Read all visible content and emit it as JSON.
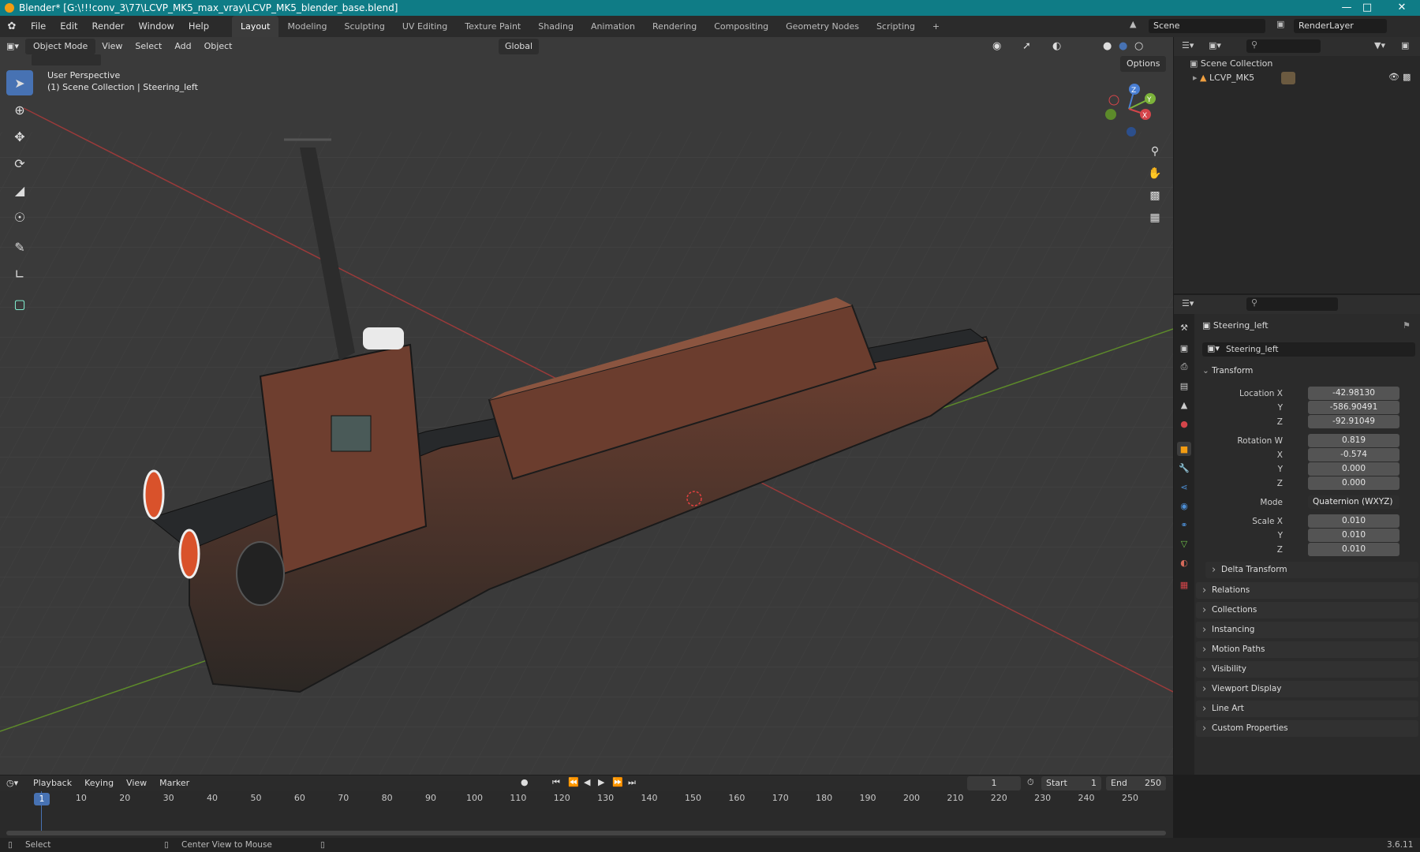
{
  "window": {
    "title": "Blender* [G:\\!!!conv_3\\77\\LCVP_MK5_max_vray\\LCVP_MK5_blender_base.blend]"
  },
  "menu": [
    "File",
    "Edit",
    "Render",
    "Window",
    "Help"
  ],
  "workspaces": [
    "Layout",
    "Modeling",
    "Sculpting",
    "UV Editing",
    "Texture Paint",
    "Shading",
    "Animation",
    "Rendering",
    "Compositing",
    "Geometry Nodes",
    "Scripting"
  ],
  "scene": {
    "name": "Scene",
    "render_layer": "RenderLayer"
  },
  "viewport": {
    "mode": "Object Mode",
    "menus": [
      "View",
      "Select",
      "Add",
      "Object"
    ],
    "orientation": "Global",
    "options": "Options",
    "overlay_title": "User Perspective",
    "overlay_sub": "(1) Scene Collection | Steering_left",
    "gizmo": {
      "z": "Z",
      "y": "Y",
      "x": "X"
    }
  },
  "outliner": {
    "root": "Scene Collection",
    "item": "LCVP_MK5"
  },
  "properties": {
    "object_name": "Steering_left",
    "data_name": "Steering_left",
    "transform_label": "Transform",
    "location": {
      "label": "Location X",
      "x": "-42.98130",
      "y": "-586.90491",
      "z": "-92.91049"
    },
    "rotation": {
      "label": "Rotation W",
      "w": "0.819",
      "x": "-0.574",
      "y": "0.000",
      "z": "0.000"
    },
    "mode_label": "Mode",
    "mode_value": "Quaternion (WXYZ)",
    "scale": {
      "label": "Scale X",
      "x": "0.010",
      "y": "0.010",
      "z": "0.010"
    },
    "axis_labels": {
      "x": "X",
      "y": "Y",
      "z": "Z"
    },
    "delta": "Delta Transform",
    "sections": [
      "Relations",
      "Collections",
      "Instancing",
      "Motion Paths",
      "Visibility",
      "Viewport Display",
      "Line Art",
      "Custom Properties"
    ]
  },
  "timeline": {
    "menus": [
      "Playback",
      "Keying",
      "View",
      "Marker"
    ],
    "current_frame": "1",
    "start_label": "Start",
    "start": "1",
    "end_label": "End",
    "end": "250",
    "ticks": [
      "1",
      "10",
      "20",
      "30",
      "40",
      "50",
      "60",
      "70",
      "80",
      "90",
      "100",
      "110",
      "120",
      "130",
      "140",
      "150",
      "160",
      "170",
      "180",
      "190",
      "200",
      "210",
      "220",
      "230",
      "240",
      "250"
    ]
  },
  "status": {
    "select": "Select",
    "center": "Center View to Mouse",
    "version": "3.6.11"
  },
  "colors": {
    "titlebar": "#0f7c86",
    "accent": "#4772b3",
    "hull_red": "#7a4535",
    "hull_dark": "#2a2c2e"
  }
}
